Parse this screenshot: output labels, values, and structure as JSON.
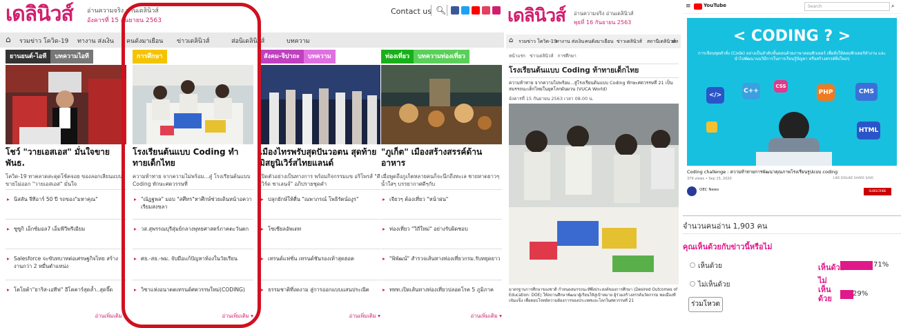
{
  "header": {
    "logo_text": "เดลินิวส์",
    "tagline": "อ่านความจริง อ่านเดลินิวส์",
    "date": "อังคารที่ 15 กันยายน 2563",
    "contact": "Contact us",
    "social_colors": [
      "#3b5998",
      "#1da1f2",
      "#ff0000",
      "#e4405f",
      "#d11f6e"
    ]
  },
  "nav": {
    "items": [
      "รวมข่าว โควิด-19",
      "ทางาน ส่งเงิน",
      "คนดังมาเยือน",
      "ข่าวเดลินิวส์",
      "ส่อนิเดลินิวส์",
      "บทความ"
    ]
  },
  "columns": [
    {
      "tabs": [
        "ยานยนต์-ไอที",
        "บทความไอที"
      ],
      "tab_colors": [
        "#333333",
        "#777777"
      ],
      "headline": "โชว์ \"วายเอสเอส\" มั่นใจขายพันธ.",
      "summary": "โควิด-19 ทาคลาดสะดุดโช้คจอย ของลอกเลียนแบบขายไม่ออก \"วายเอสเอส\" มั่นใจ",
      "links": [
        "นิสสัน จีทีอาร์ 50 ปี รถของ\"มหาคุณ\"",
        "ซูซูกิ เอ็กซ์มอล7 เอ็มพีวีพรีเมียม",
        "Salesforce จะขับทบาทต่อเศรษฐกิจไทย สร้างงานกว่า 2 หมื่นตำแหน่ง",
        "โตโยต้า\"ยาริส-เอทีฟ\" อีโคคาร์สุดล้ำ..สุดจี๊ด"
      ],
      "more": "อ่านเพิ่มเติม ▾"
    },
    {
      "tabs": [
        "การศึกษา"
      ],
      "tab_colors": [
        "#f5c400"
      ],
      "headline": "โรงเรียนต้นแบบ Coding ทำทายเด็กไทย",
      "summary": "ความท้าทาย จากความไม่พร้อม...สู่ โรงเรียนต้นแบบ Coding ทักษะศตวรรษที่",
      "links": [
        "\"ณัฏฐพล\" มอบ \"สศึทร\"หาศึกษ์ช่วยเดินหน้าอควาเรียมสงขลา",
        "วส.สุพรรณบุรีสุ่มย์กลางพุทธศาสตร์ภาคตะวันตก",
        "ศธ.-สธ.-พม. จับมือแก้ปัญหาท้องในวัยเรียน",
        "วิชาแห่งอนาคตเทรนด์ศตวรรษใหม่(CODING)"
      ],
      "more": "อ่านเพิ่มเติม ▾"
    },
    {
      "tabs": [
        "สังคม-จิปาถะ",
        "บทความ"
      ],
      "tab_colors": [
        "#c040c0",
        "#e070e0"
      ],
      "headline": "เมืองไทรพรับสุดปันวอตน สุดท้าย มิสยูนิเวิร์สไทยแลนด์",
      "summary": "เปิดตัวอย่างเป็นทางการ พร้อมกิจกรรมแข อริโพรส์ \"ดีเวิร์ด ชาเลนจ์\" อภิปรายชุดคำ",
      "links": [
        "ปลุกยักษ์ให้ตื่น \"ณพาภรณ์ โพธิรัตน์องูร\"",
        "โซเซียลอัพเดท",
        "เทรนด์แฟชั่น เทรนด์ชันรองเท้าสุดฮอต",
        "ธรรมชาติที่งดงาม สู่การออกแบบแสนประณีต"
      ],
      "more": "อ่านเพิ่มเติม ▾"
    },
    {
      "tabs": [
        "ท่องเที่ยว",
        "บทความท่องเที่ยว"
      ],
      "tab_colors": [
        "#18b018",
        "#5ad05a"
      ],
      "headline": "\"ภูเก็ต\" เมืองสร้างสรรค์ด้านอาหาร",
      "summary": "เมื่อพูดถึงภูเก็ตหลายคนก็จะนึกถึงทะเล ชายหาดยาวๆ น้ำใสๆ บรรยากาศดีๆกับ",
      "links": [
        "เจียวๆ ต้องเที่ยว \"หน้าฝน\"",
        "ท่องเที่ยว \"วิถีใหม่\" อย่างรับผิดชอบ",
        "\"พิพัฒน์\" สำรวจเส้นทางท่องเที่ยวกรม.รับหยุดยาว",
        "ททท.เปิดเส้นทางท่องเที่ยวปลอดโรค 5 ภูมิภาค"
      ],
      "more": "อ่านเพิ่มเติม ▾"
    }
  ],
  "article": {
    "logo_text": "เดลินิวส์",
    "tagline": "อ่านความจริง อ่านเดลินิวส์",
    "date": "พุธที่ 16 กันยายน 2563",
    "nav": [
      "รวมข่าว โควิด-19",
      "ทางาน ส่งเงิน",
      "คนดังมาเยือน",
      "ข่าวเดลินิวส์",
      "สถานีเดลินิวส์",
      "บท"
    ],
    "breadcrumb": [
      "หน้าแรก",
      "ข่าวเดลินิวส์",
      "การศึกษา"
    ],
    "title": "โรงเรียนต้นแบบ Coding ท้าทายเด็กไทย",
    "lead": "ความท้าทาย จากความไม่พร้อม...สู่โรงเรียนต้นแบบ Coding ทักษะศตวรรษที่ 21 เป็นสมรรถนะเด็กไทยในยุคโลกผันผวน (VUCA World)",
    "byline": "อังคารที่ 15 กันยายน 2563 เวลา 08.00 น.",
    "footer": "มาตรฐานการศึกษาของชาติ กำหนดสมรรถนะที่พึงประสงค์ของการศึกษา (Desired Outcomes of Education: DOE) ให้สถานศึกษาพัฒนาผู้เรียนให้สู่เป้าหมาย ผู้ร่วมสร้างสรรค์นวัตกรรม พลเมืองที่เข้มแข็ง เพื่อตอบโจทย์ความต้องการของประเทศและโลกในศตวรรษที่ 21"
  },
  "video": {
    "site": "YouTube",
    "search_placeholder": "Search",
    "headline": "< CODING ? >",
    "subtitle": "การเขียนชุดคำสั่ง (Code) อย่างเป็นลำดับขั้นตอนด้วยภาษาคอมพิวเตอร์ เพื่อสั่งให้คอมพิวเตอร์ทำงาน และนำไปพัฒนาบนวิธีการในการเรียนรู้ปัญหา หรือสร้างสรรค์สิ่งใหม่ๆ",
    "icons": [
      "</>",
      "C++",
      "CSS",
      "PHP",
      "CMS",
      "HTML"
    ],
    "video_title": "Coding challenge : ความท้าทายการพัฒนาคุณภาพโรงเรียนรูปแบบ coding",
    "video_meta": "379 views • Sep 15, 2020",
    "likes": "LIKE  DISLIKE  SHARE  SAVE",
    "channel": "OEC News",
    "subscribe": "SUBSCRIBE",
    "views_label": "จำนวนคนอ่าน 1,903 คน"
  },
  "poll": {
    "question": "คุณเห็นด้วยกับข่าวนี้หรือไม่",
    "options": [
      {
        "label": "เห็นด้วย",
        "result_label": "เห็นด้วย",
        "percent": 71,
        "percent_text": "71%"
      },
      {
        "label": "ไม่เห็นด้วย",
        "result_label": "ไม่เห็นด้วย",
        "percent": 29,
        "percent_text": "29%"
      }
    ],
    "vote_button": "ร่วมโหวต",
    "accent": "#e0188a"
  },
  "annotation_color": "#d01020"
}
